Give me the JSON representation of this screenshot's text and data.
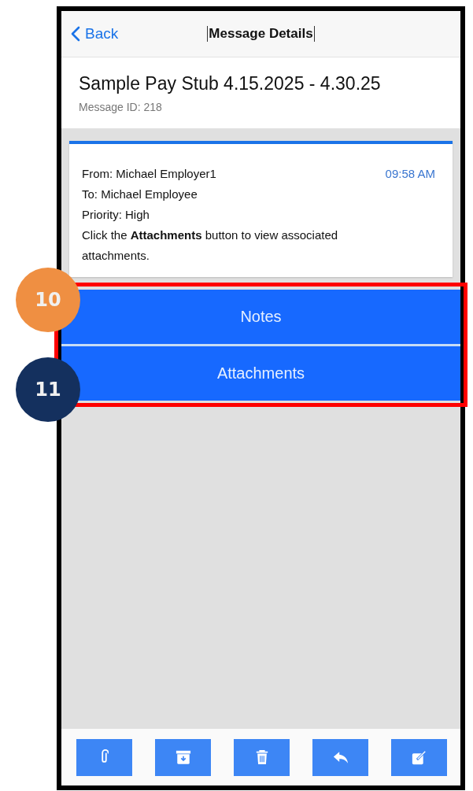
{
  "nav": {
    "back_label": "Back",
    "title": "Message Details"
  },
  "message": {
    "subject": "Sample Pay Stub 4.15.2025 - 4.30.25",
    "id_label": "Message ID: 218"
  },
  "card": {
    "from": "From: Michael Employer1",
    "time": "09:58 AM",
    "to": "To: Michael Employee",
    "priority": "Priority: High",
    "body": "Click the **Attachments** button to view associated attachments."
  },
  "action_group": {
    "highlighted": true,
    "buttons": [
      {
        "label": "Notes",
        "callout": {
          "label": "10",
          "color": "#ef8f42"
        }
      },
      {
        "label": "Attachments",
        "callout": {
          "label": "11",
          "color": "#14305e"
        }
      }
    ]
  },
  "toolbar": [
    {
      "kind": "attachment"
    },
    {
      "kind": "archive"
    },
    {
      "kind": "delete"
    },
    {
      "kind": "reply"
    },
    {
      "kind": "compose"
    }
  ]
}
